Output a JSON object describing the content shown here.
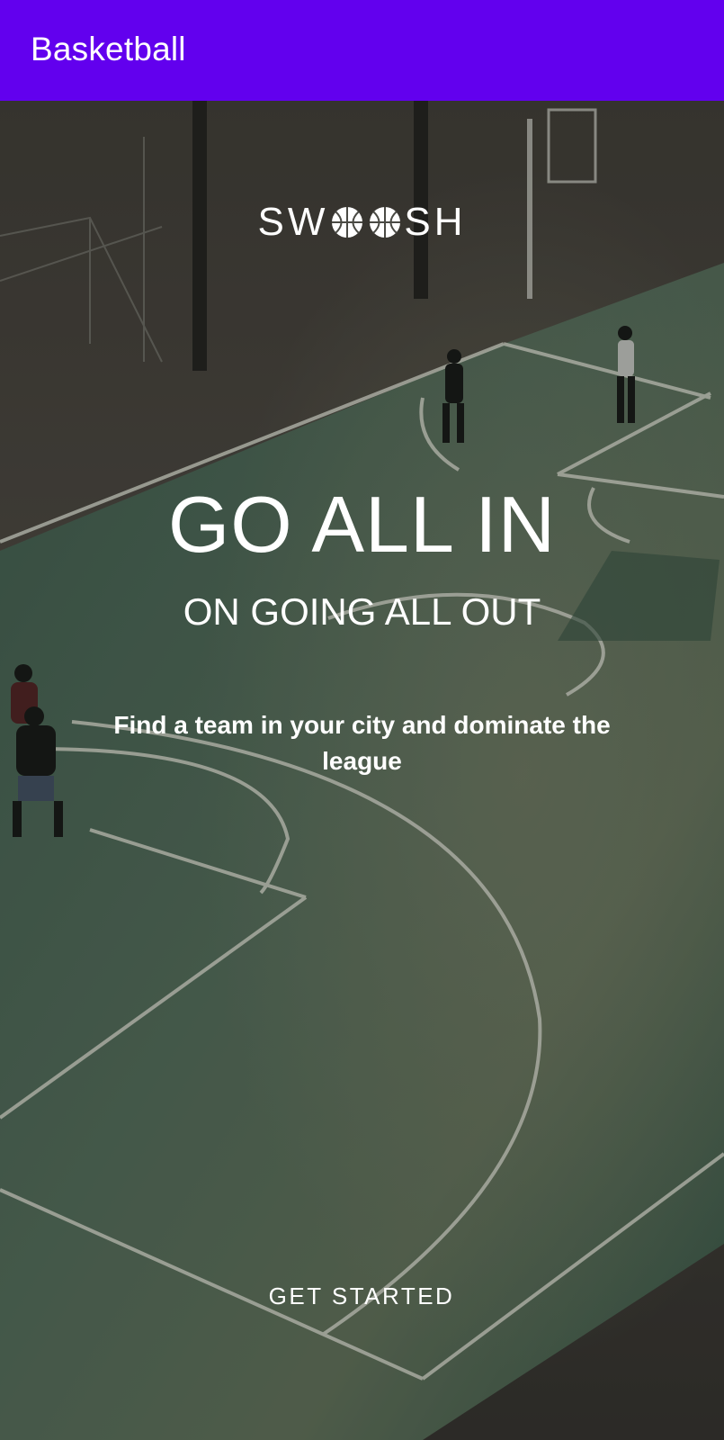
{
  "app_bar": {
    "title": "Basketball",
    "color": "#6200ee"
  },
  "logo": {
    "prefix": "SW",
    "suffix": "SH",
    "icons": [
      "basketball-icon",
      "basketball-icon"
    ]
  },
  "hero": {
    "headline": "GO ALL IN",
    "subheadline": "ON GOING ALL OUT",
    "description": "Find a team in your city and dominate the league"
  },
  "actions": {
    "get_started_label": "GET STARTED"
  },
  "background": {
    "description_icon": "basketball-court-image"
  }
}
